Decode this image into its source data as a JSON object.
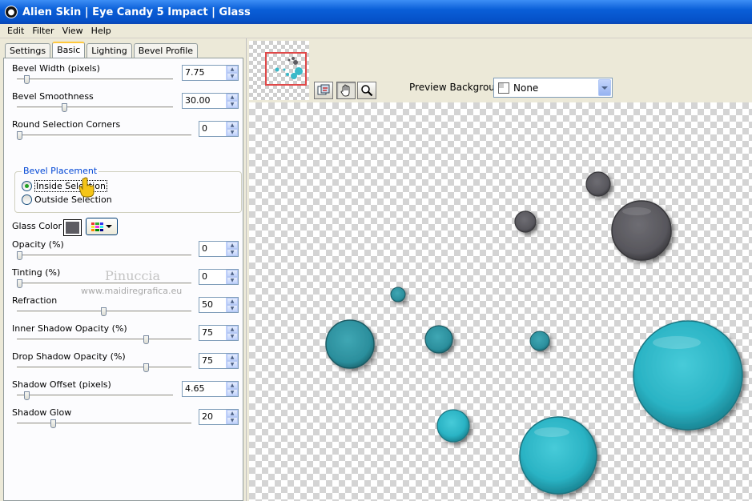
{
  "window": {
    "title": "Alien Skin | Eye Candy 5 Impact | Glass"
  },
  "menu": [
    "Edit",
    "Filter",
    "View",
    "Help"
  ],
  "tabs": [
    "Settings",
    "Basic",
    "Lighting",
    "Bevel Profile"
  ],
  "active_tab": "Basic",
  "controls": {
    "bevel_width": {
      "label": "Bevel Width (pixels)",
      "value": "7.75",
      "level": 0.05
    },
    "bevel_smoothness": {
      "label": "Bevel Smoothness",
      "value": "30.00",
      "level": 0.3
    },
    "round_selection_corners": {
      "label": "Round Selection Corners",
      "value": "0",
      "level": 0.0
    },
    "bevel_placement": {
      "legend": "Bevel Placement",
      "options": [
        "Inside Selection",
        "Outside Selection"
      ],
      "selected": "Inside Selection"
    },
    "glass_color": {
      "label": "Glass Color",
      "color": "#5d5c62"
    },
    "opacity": {
      "label": "Opacity (%)",
      "value": "0",
      "level": 0.0
    },
    "tinting": {
      "label": "Tinting (%)",
      "value": "0",
      "level": 0.0
    },
    "refraction": {
      "label": "Refraction",
      "value": "50",
      "level": 0.5
    },
    "inner_shadow_opacity": {
      "label": "Inner Shadow Opacity (%)",
      "value": "75",
      "level": 0.75
    },
    "drop_shadow_opacity": {
      "label": "Drop Shadow Opacity (%)",
      "value": "75",
      "level": 0.75
    },
    "shadow_offset": {
      "label": "Shadow Offset (pixels)",
      "value": "4.65",
      "level": 0.05
    },
    "shadow_glow": {
      "label": "Shadow Glow",
      "value": "20",
      "level": 0.2
    }
  },
  "watermark": {
    "line1": "Pinuccia",
    "line2": "www.maidiregrafica.eu"
  },
  "preview": {
    "background_label": "Preview Background:",
    "background_value": "None"
  },
  "colors": {
    "teal": "#3ab9c9",
    "gray_bubble": "#5d5c62",
    "title_blue": "#0a5fd8"
  },
  "icons": [
    "preview-toggle-icon",
    "hand-pan-icon",
    "zoom-magnifier-icon"
  ]
}
